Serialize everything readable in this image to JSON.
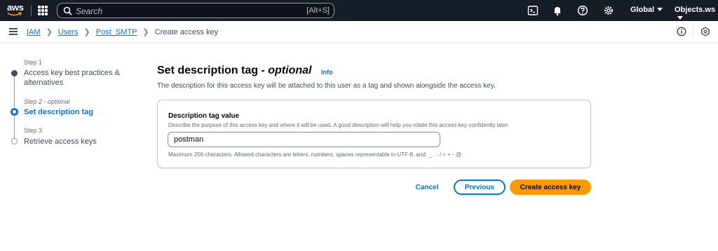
{
  "topbar": {
    "logo_text": "aws",
    "search_placeholder": "Search",
    "search_shortcut": "[Alt+S]",
    "icons": [
      "cloudshell-icon",
      "bell-icon",
      "help-icon",
      "gear-icon"
    ],
    "region": "Global",
    "account": "Objects.ws"
  },
  "breadcrumb": {
    "items": [
      "IAM",
      "Users",
      "Post_SMTP"
    ],
    "current": "Create access key"
  },
  "steps": [
    {
      "number": "Step 1",
      "title": "Access key best practices & alternatives",
      "state": "completed"
    },
    {
      "number": "Step 2 - optional",
      "title": "Set description tag",
      "state": "active"
    },
    {
      "number": "Step 3",
      "title": "Retrieve access keys",
      "state": "upcoming"
    }
  ],
  "main": {
    "title": "Set description tag - ",
    "title_emphasis": "optional",
    "info_link": "Info",
    "description": "The description for this access key will be attached to this user as a tag and shown alongside the access key."
  },
  "form": {
    "label": "Description tag value",
    "help": "Describe the purpose of this access key and where it will be used. A good description will help you rotate this access key confidently later.",
    "value": "postman",
    "constraint": "Maximum 256 characters. Allowed characters are letters, numbers, spaces representable in UTF-8, and: _ . : / = + - @"
  },
  "actions": {
    "cancel": "Cancel",
    "previous": "Previous",
    "create": "Create access key"
  },
  "colors": {
    "topbar_bg": "#161d26",
    "link": "#0972d3",
    "primary_button": "#ff9900"
  }
}
